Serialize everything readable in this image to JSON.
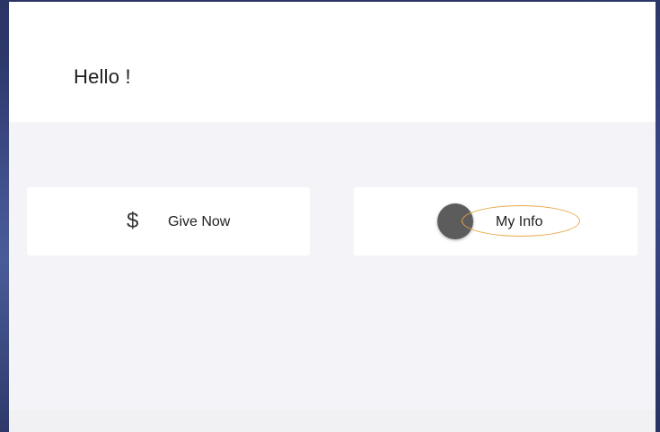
{
  "header": {
    "greeting": "Hello !"
  },
  "actions": [
    {
      "label": "Give Now",
      "icon": "dollar-icon",
      "icon_glyph": "$"
    },
    {
      "label": "My Info",
      "icon": "touch-indicator"
    }
  ],
  "colors": {
    "background": "#2f3a6e",
    "panel": "#f4f4f8",
    "card": "#ffffff",
    "highlight": "#e8a94a",
    "touch_dot": "#5c5c5c"
  }
}
